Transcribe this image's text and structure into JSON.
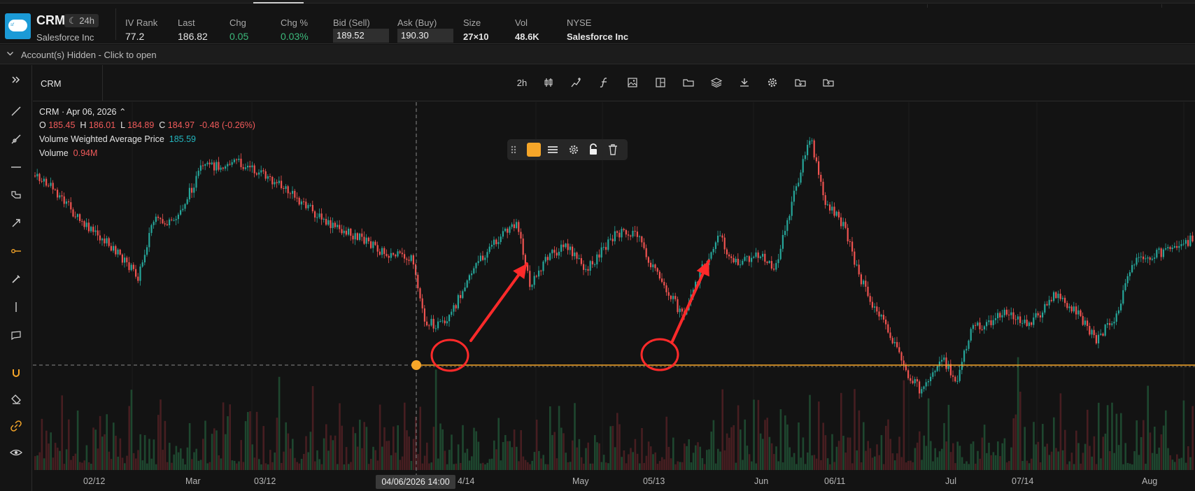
{
  "quote": {
    "symbol": "CRM",
    "session_badge": "24h",
    "company": "Salesforce Inc",
    "fields": [
      {
        "label": "IV Rank",
        "value": "77.2"
      },
      {
        "label": "Last",
        "value": "186.82"
      },
      {
        "label": "Chg",
        "value": "0.05"
      },
      {
        "label": "Chg %",
        "value": "0.03%"
      },
      {
        "label": "Bid (Sell)",
        "value": "189.52"
      },
      {
        "label": "Ask (Buy)",
        "value": "190.30"
      },
      {
        "label": "Size",
        "value": "27×10"
      },
      {
        "label": "Vol",
        "value": "48.6K"
      },
      {
        "label": "NYSE",
        "value": "Salesforce Inc"
      }
    ]
  },
  "accounts_bar": {
    "text": "Account(s) Hidden - Click to open"
  },
  "chart_header": {
    "symbol": "CRM",
    "interval": "2h"
  },
  "legend": {
    "title": "CRM · Apr 06, 2026",
    "open_label": "O",
    "open": "185.45",
    "high_label": "H",
    "high": "186.01",
    "low_label": "L",
    "low": "184.89",
    "close_label": "C",
    "close": "184.97",
    "change": "-0.48 (-0.26%)",
    "vwap_label": "Volume Weighted Average Price",
    "vwap": "185.59",
    "volume_label": "Volume",
    "volume": "0.94M"
  },
  "crosshair": {
    "time_label": "04/06/2026 14:00"
  },
  "x_axis": {
    "ticks": [
      "02/12",
      "Mar",
      "03/12",
      "4/14",
      "May",
      "05/13",
      "Jun",
      "06/11",
      "Jul",
      "07/14",
      "Aug"
    ]
  },
  "colors": {
    "up": "#26a69a",
    "down": "#ef5350",
    "accent": "#f6a629",
    "annotation": "#ff2a2a"
  },
  "icons": {
    "left_toolbar": [
      "expand-icon",
      "trendline-icon",
      "ray-icon",
      "horizontal-line-icon",
      "brush-icon",
      "arrow-icon",
      "horizontal-ray-icon",
      "pen-icon",
      "vertical-line-icon",
      "callout-icon",
      "magnet-icon",
      "eraser-icon",
      "link-icon",
      "eye-icon"
    ],
    "header": [
      "candlestick-icon",
      "indicators-icon",
      "function-icon",
      "image-icon",
      "layout-icon",
      "folder-icon",
      "layers-icon",
      "download-icon",
      "settings-icon",
      "save-folder-icon",
      "upload-icon"
    ]
  }
}
